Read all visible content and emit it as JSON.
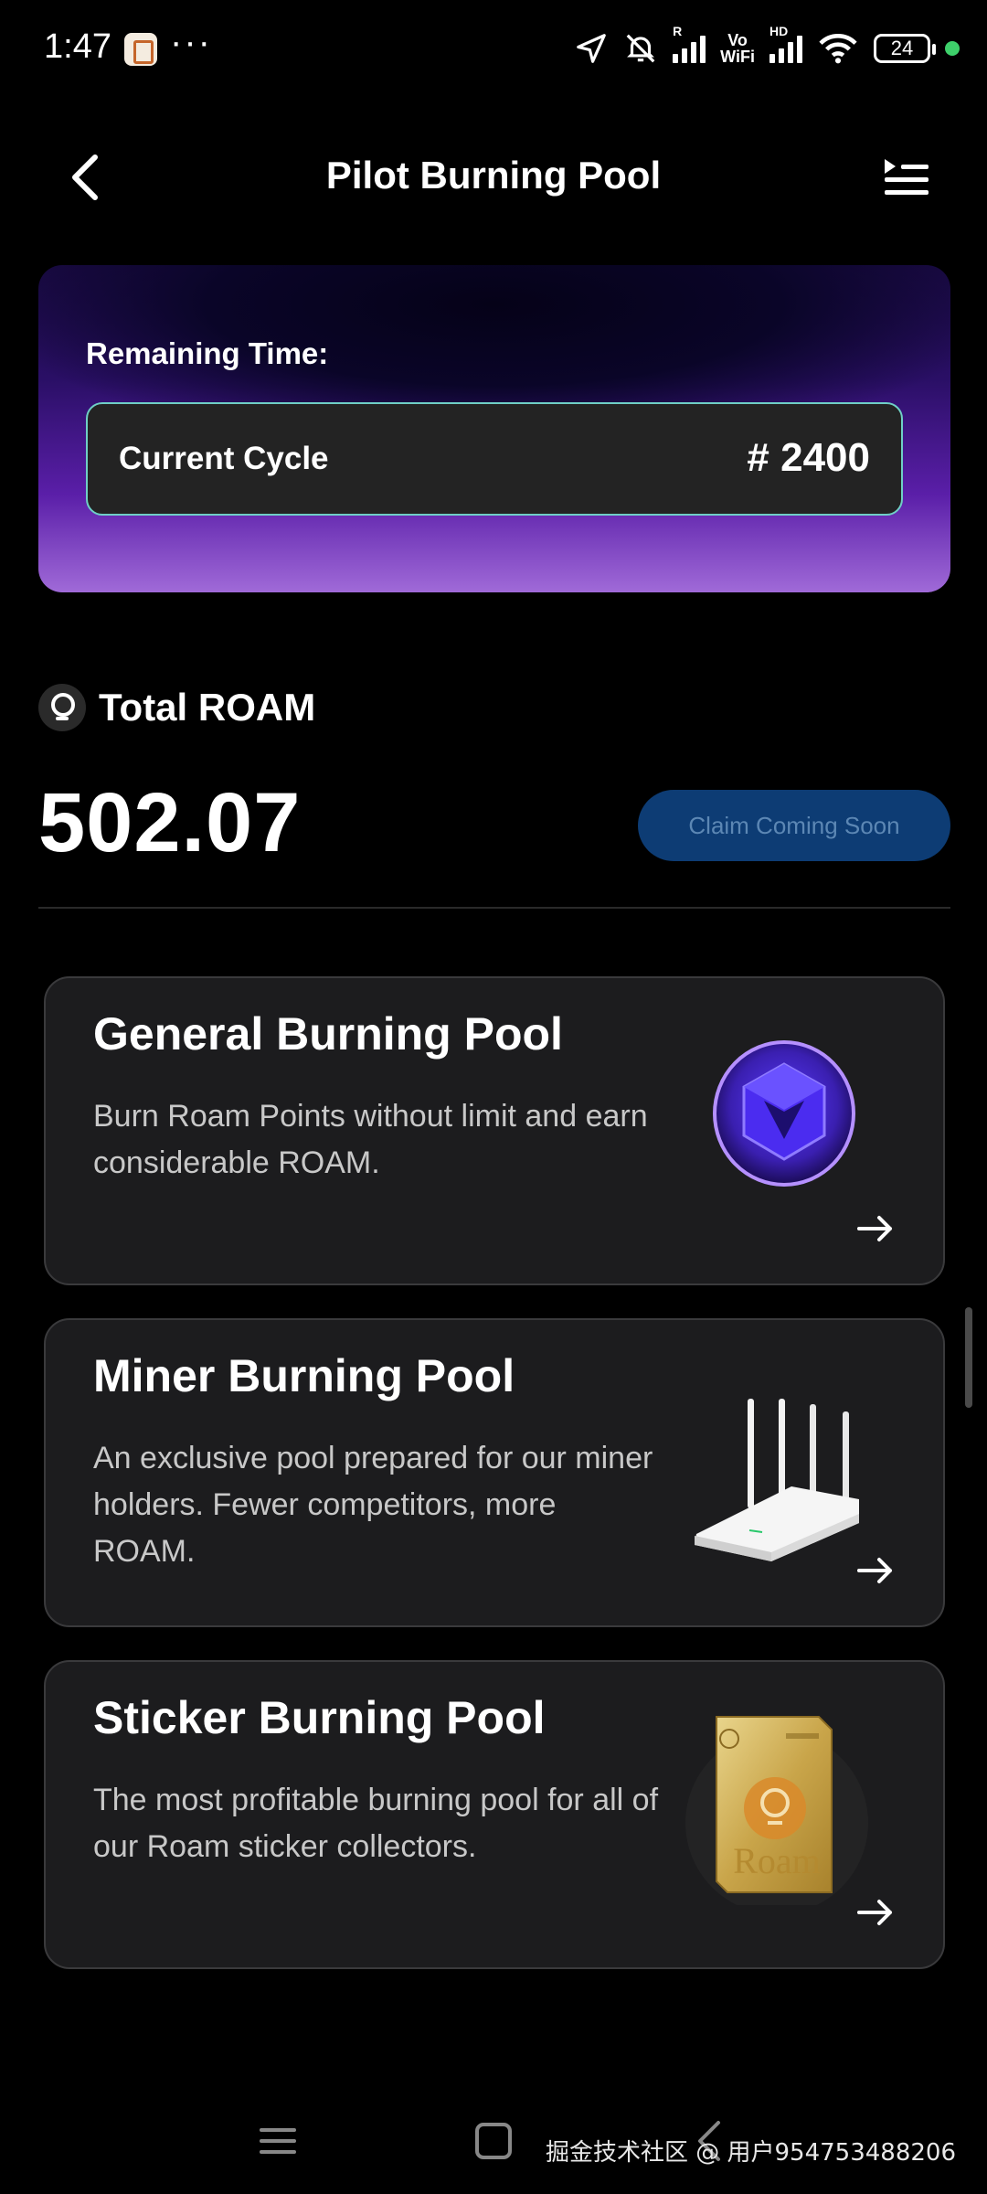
{
  "status_bar": {
    "time": "1:47",
    "dots": "···",
    "r_label": "R",
    "vo_label": "Vo",
    "wifi_label": "WiFi",
    "hd_label": "HD",
    "battery": "24"
  },
  "header": {
    "title": "Pilot Burning Pool"
  },
  "cycle": {
    "remaining_label": "Remaining Time:",
    "current_label": "Current Cycle",
    "value": "# 2400"
  },
  "total": {
    "label": "Total ROAM",
    "value": "502.07",
    "claim_label": "Claim Coming Soon"
  },
  "pools": [
    {
      "title": "General Burning Pool",
      "description": "Burn Roam Points without limit and earn considerable ROAM."
    },
    {
      "title": "Miner Burning Pool",
      "description": "An exclusive pool prepared for our miner holders. Fewer competitors, more ROAM."
    },
    {
      "title": "Sticker Burning Pool",
      "description": "The most profitable burning pool for all of our Roam sticker collectors."
    }
  ],
  "sticker_text": "Roam",
  "watermark": "掘金技术社区 @ 用户954753488206",
  "colors": {
    "accent_border": "#6fcfc6",
    "claim_button_bg": "#0d3c74",
    "card_bg": "#1c1c1e"
  }
}
